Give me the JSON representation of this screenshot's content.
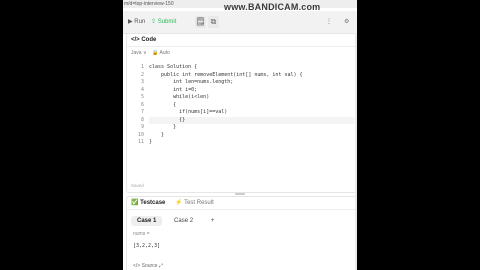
{
  "url_text": "m/d=top-interview-150",
  "watermark": "www.BANDICAM.com",
  "toolbar": {
    "run_label": "▶ Run",
    "submit_label": "⇪ Submit",
    "icon1": "🗒",
    "icon2": "⧉",
    "more_icon": "⋮",
    "settings_icon": "⚙"
  },
  "code_panel": {
    "title": "</> Code",
    "language": "Java ∨",
    "auto": "🔒 Auto",
    "line_numbers": [
      "1",
      "2",
      "3",
      "4",
      "5",
      "6",
      "7",
      "8",
      "9",
      "10",
      "11"
    ],
    "lines": [
      "class Solution {",
      "    public int removeElement(int[] nums, int val) {",
      "        int len=nums.length;",
      "        int i=0;",
      "        while(i<len)",
      "        {",
      "          if(nums[i]==val)",
      "          {}",
      "        }",
      "    }",
      "}"
    ],
    "footer": "Saved"
  },
  "test_panel": {
    "tab_testcase": "✅ Testcase",
    "tab_result": "⚡ Test Result",
    "case1": "Case 1",
    "case2": "Case 2",
    "add": "+",
    "input_label": "nums =",
    "input_value": "[3,2,2,3]",
    "source": "</> Source ⤢"
  }
}
